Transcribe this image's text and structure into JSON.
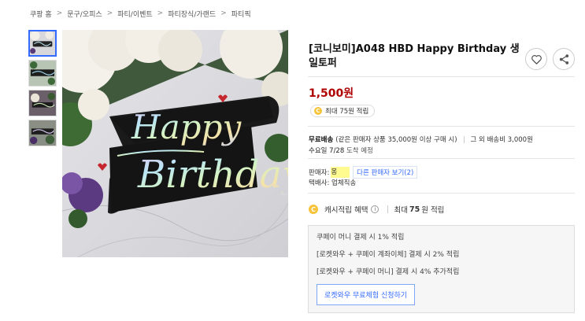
{
  "breadcrumb": [
    "쿠팡 홈",
    "문구/오피스",
    "파티/이벤트",
    "파티장식/가랜드",
    "파티픽"
  ],
  "breadcrumb_separator": ">",
  "product": {
    "title": "[코니보미]A048 HBD Happy Birthday 생일토퍼",
    "price": "1,500원",
    "reward_chip": "최대 75원 적립",
    "image_text": [
      "Happy",
      "Birthday"
    ]
  },
  "shipping": {
    "label": "무료배송",
    "condition": "(같은 판매자 상품 35,000원 이상 구매 시)",
    "other": "그 외 배송비 3,000원",
    "arrival_date": "수요일 7/28",
    "arrival_suffix": "도착 예정"
  },
  "seller": {
    "label": "판매자:",
    "name": "몽",
    "other_sellers_link": "다른 판매자 보기(2)",
    "delivery_label": "택배사:",
    "delivery_value": "업체직송"
  },
  "cash": {
    "label": "캐시적립 혜택",
    "info_icon": "ⓘ",
    "max_prefix": "최대",
    "max_amount": "75",
    "max_suffix": "원 적립"
  },
  "benefits": [
    "쿠페이 머니 결제 시 1% 적립",
    "[로켓와우 + 쿠페이 계좌이체] 결제 시 2% 적립",
    "[로켓와우 + 쿠페이 머니] 결제 시 4% 추가적립"
  ],
  "trial_button": "로켓와우 무료체험 신청하기",
  "icons": {
    "coin": "C",
    "heart": "heart-icon",
    "share": "share-icon"
  },
  "colors": {
    "price": "#ae0000",
    "accent": "#346aff",
    "coin": "#f6c33a"
  }
}
